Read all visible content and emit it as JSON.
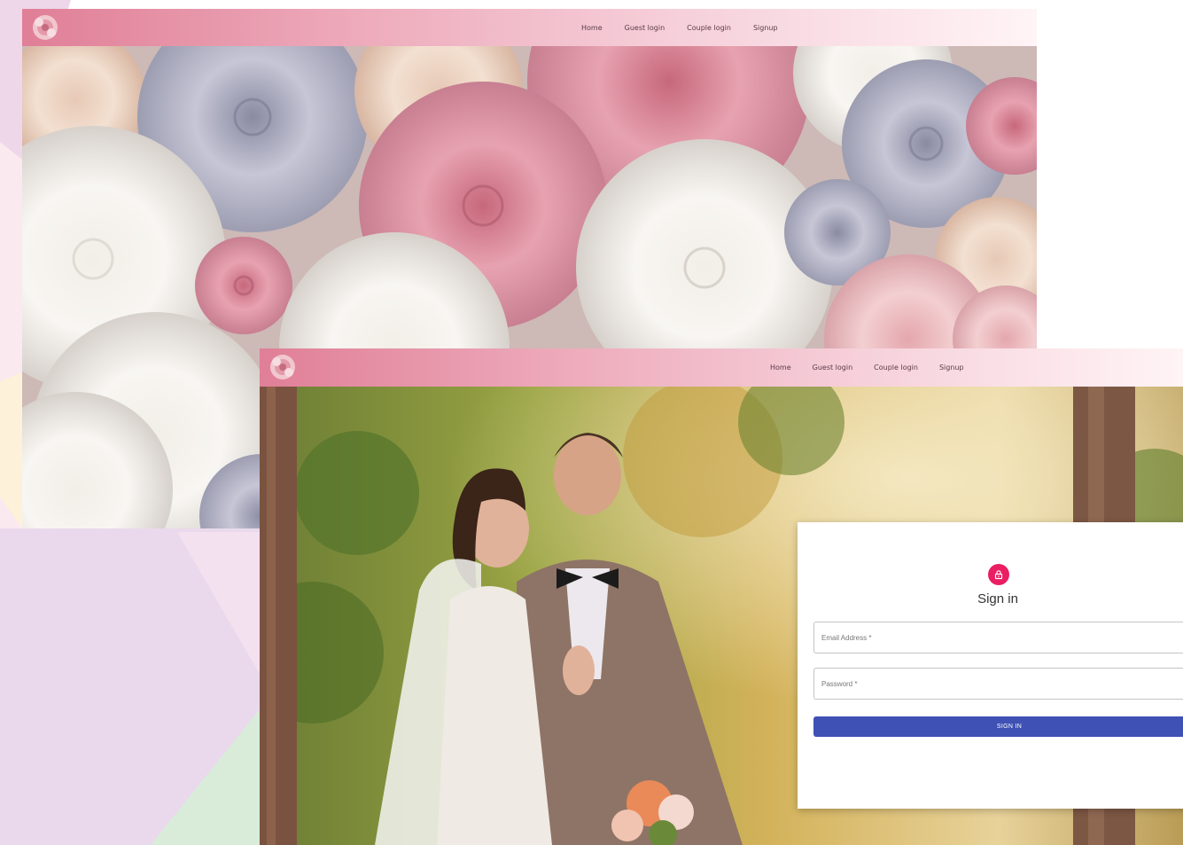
{
  "screen1": {
    "nav": {
      "items": [
        "Home",
        "Guest login",
        "Couple login",
        "Signup"
      ]
    }
  },
  "screen2": {
    "nav": {
      "items": [
        "Home",
        "Guest login",
        "Couple login",
        "Signup"
      ]
    },
    "signin": {
      "title": "Sign in",
      "email_placeholder": "Email Address *",
      "password_placeholder": "Password *",
      "button_label": "SIGN IN"
    }
  },
  "colors": {
    "nav_gradient_start": "#e07f97",
    "nav_gradient_end": "#fff4f6",
    "lock_avatar": "#e91e63",
    "signin_button": "#3f51b5"
  },
  "icons": [
    "rose-logo-icon",
    "lock-icon"
  ]
}
